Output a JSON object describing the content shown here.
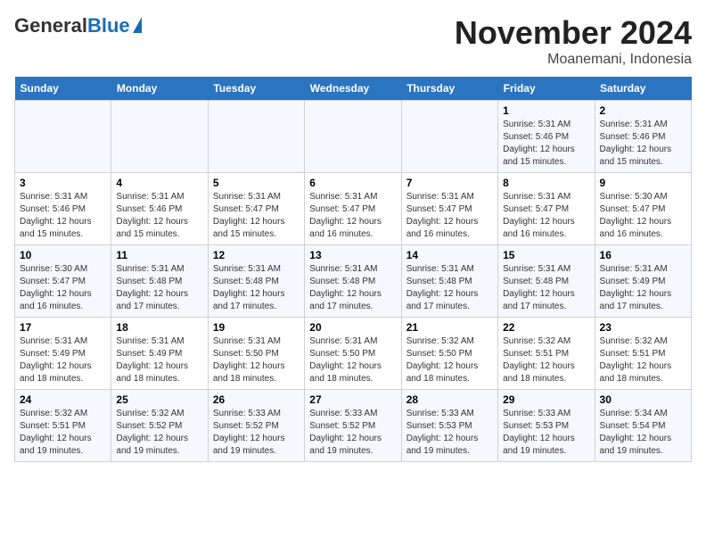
{
  "header": {
    "logo_general": "General",
    "logo_blue": "Blue",
    "title": "November 2024",
    "subtitle": "Moanemani, Indonesia"
  },
  "weekdays": [
    "Sunday",
    "Monday",
    "Tuesday",
    "Wednesday",
    "Thursday",
    "Friday",
    "Saturday"
  ],
  "weeks": [
    [
      {
        "day": "",
        "info": ""
      },
      {
        "day": "",
        "info": ""
      },
      {
        "day": "",
        "info": ""
      },
      {
        "day": "",
        "info": ""
      },
      {
        "day": "",
        "info": ""
      },
      {
        "day": "1",
        "info": "Sunrise: 5:31 AM\nSunset: 5:46 PM\nDaylight: 12 hours and 15 minutes."
      },
      {
        "day": "2",
        "info": "Sunrise: 5:31 AM\nSunset: 5:46 PM\nDaylight: 12 hours and 15 minutes."
      }
    ],
    [
      {
        "day": "3",
        "info": "Sunrise: 5:31 AM\nSunset: 5:46 PM\nDaylight: 12 hours and 15 minutes."
      },
      {
        "day": "4",
        "info": "Sunrise: 5:31 AM\nSunset: 5:46 PM\nDaylight: 12 hours and 15 minutes."
      },
      {
        "day": "5",
        "info": "Sunrise: 5:31 AM\nSunset: 5:47 PM\nDaylight: 12 hours and 15 minutes."
      },
      {
        "day": "6",
        "info": "Sunrise: 5:31 AM\nSunset: 5:47 PM\nDaylight: 12 hours and 16 minutes."
      },
      {
        "day": "7",
        "info": "Sunrise: 5:31 AM\nSunset: 5:47 PM\nDaylight: 12 hours and 16 minutes."
      },
      {
        "day": "8",
        "info": "Sunrise: 5:31 AM\nSunset: 5:47 PM\nDaylight: 12 hours and 16 minutes."
      },
      {
        "day": "9",
        "info": "Sunrise: 5:30 AM\nSunset: 5:47 PM\nDaylight: 12 hours and 16 minutes."
      }
    ],
    [
      {
        "day": "10",
        "info": "Sunrise: 5:30 AM\nSunset: 5:47 PM\nDaylight: 12 hours and 16 minutes."
      },
      {
        "day": "11",
        "info": "Sunrise: 5:31 AM\nSunset: 5:48 PM\nDaylight: 12 hours and 17 minutes."
      },
      {
        "day": "12",
        "info": "Sunrise: 5:31 AM\nSunset: 5:48 PM\nDaylight: 12 hours and 17 minutes."
      },
      {
        "day": "13",
        "info": "Sunrise: 5:31 AM\nSunset: 5:48 PM\nDaylight: 12 hours and 17 minutes."
      },
      {
        "day": "14",
        "info": "Sunrise: 5:31 AM\nSunset: 5:48 PM\nDaylight: 12 hours and 17 minutes."
      },
      {
        "day": "15",
        "info": "Sunrise: 5:31 AM\nSunset: 5:48 PM\nDaylight: 12 hours and 17 minutes."
      },
      {
        "day": "16",
        "info": "Sunrise: 5:31 AM\nSunset: 5:49 PM\nDaylight: 12 hours and 17 minutes."
      }
    ],
    [
      {
        "day": "17",
        "info": "Sunrise: 5:31 AM\nSunset: 5:49 PM\nDaylight: 12 hours and 18 minutes."
      },
      {
        "day": "18",
        "info": "Sunrise: 5:31 AM\nSunset: 5:49 PM\nDaylight: 12 hours and 18 minutes."
      },
      {
        "day": "19",
        "info": "Sunrise: 5:31 AM\nSunset: 5:50 PM\nDaylight: 12 hours and 18 minutes."
      },
      {
        "day": "20",
        "info": "Sunrise: 5:31 AM\nSunset: 5:50 PM\nDaylight: 12 hours and 18 minutes."
      },
      {
        "day": "21",
        "info": "Sunrise: 5:32 AM\nSunset: 5:50 PM\nDaylight: 12 hours and 18 minutes."
      },
      {
        "day": "22",
        "info": "Sunrise: 5:32 AM\nSunset: 5:51 PM\nDaylight: 12 hours and 18 minutes."
      },
      {
        "day": "23",
        "info": "Sunrise: 5:32 AM\nSunset: 5:51 PM\nDaylight: 12 hours and 18 minutes."
      }
    ],
    [
      {
        "day": "24",
        "info": "Sunrise: 5:32 AM\nSunset: 5:51 PM\nDaylight: 12 hours and 19 minutes."
      },
      {
        "day": "25",
        "info": "Sunrise: 5:32 AM\nSunset: 5:52 PM\nDaylight: 12 hours and 19 minutes."
      },
      {
        "day": "26",
        "info": "Sunrise: 5:33 AM\nSunset: 5:52 PM\nDaylight: 12 hours and 19 minutes."
      },
      {
        "day": "27",
        "info": "Sunrise: 5:33 AM\nSunset: 5:52 PM\nDaylight: 12 hours and 19 minutes."
      },
      {
        "day": "28",
        "info": "Sunrise: 5:33 AM\nSunset: 5:53 PM\nDaylight: 12 hours and 19 minutes."
      },
      {
        "day": "29",
        "info": "Sunrise: 5:33 AM\nSunset: 5:53 PM\nDaylight: 12 hours and 19 minutes."
      },
      {
        "day": "30",
        "info": "Sunrise: 5:34 AM\nSunset: 5:54 PM\nDaylight: 12 hours and 19 minutes."
      }
    ]
  ]
}
